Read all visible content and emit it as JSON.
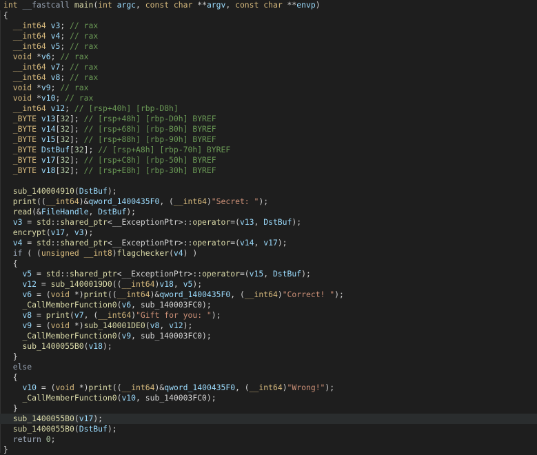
{
  "editor": {
    "lines": [
      "int __fastcall main(int argc, const char **argv, const char **envp)",
      "{",
      "  __int64 v3; // rax",
      "  __int64 v4; // rax",
      "  __int64 v5; // rax",
      "  void *v6; // rax",
      "  __int64 v7; // rax",
      "  __int64 v8; // rax",
      "  void *v9; // rax",
      "  void *v10; // rax",
      "  __int64 v12; // [rsp+40h] [rbp-D8h]",
      "  _BYTE v13[32]; // [rsp+48h] [rbp-D0h] BYREF",
      "  _BYTE v14[32]; // [rsp+68h] [rbp-B0h] BYREF",
      "  _BYTE v15[32]; // [rsp+88h] [rbp-90h] BYREF",
      "  _BYTE DstBuf[32]; // [rsp+A8h] [rbp-70h] BYREF",
      "  _BYTE v17[32]; // [rsp+C8h] [rbp-50h] BYREF",
      "  _BYTE v18[32]; // [rsp+E8h] [rbp-30h] BYREF",
      "",
      "  sub_140004910(DstBuf);",
      "  print((__int64)&qword_1400435F0, (__int64)\"Secret: \");",
      "  read(&FileHandle, DstBuf);",
      "  v3 = std::shared_ptr<__ExceptionPtr>::operator=(v13, DstBuf);",
      "  encrypt(v17, v3);",
      "  v4 = std::shared_ptr<__ExceptionPtr>::operator=(v14, v17);",
      "  if ( (unsigned __int8)flagchecker(v4) )",
      "  {",
      "    v5 = std::shared_ptr<__ExceptionPtr>::operator=(v15, DstBuf);",
      "    v12 = sub_1400019D0((__int64)v18, v5);",
      "    v6 = (void *)print((__int64)&qword_1400435F0, (__int64)\"Correct! \");",
      "    _CallMemberFunction0(v6, sub_140003FC0);",
      "    v8 = print(v7, (__int64)\"Gift for you: \");",
      "    v9 = (void *)sub_140001DE0(v8, v12);",
      "    _CallMemberFunction0(v9, sub_140003FC0);",
      "    sub_1400055B0(v18);",
      "  }",
      "  else",
      "  {",
      "    v10 = (void *)print((__int64)&qword_1400435F0, (__int64)\"Wrong!\");",
      "    _CallMemberFunction0(v10, sub_140003FC0);",
      "  }",
      "  sub_1400055B0(v17);",
      "  sub_1400055B0(DstBuf);",
      "  return 0;",
      "}"
    ],
    "colors": {
      "background": "#1e1e1e",
      "keyword": "#9aa6b6",
      "type": "#d7ba7d",
      "comment": "#6a9955",
      "string": "#ce9178",
      "function": "#dcdcaa",
      "variable": "#9cdcfe",
      "number": "#b5cea8",
      "plain": "#d4d4d4"
    }
  }
}
